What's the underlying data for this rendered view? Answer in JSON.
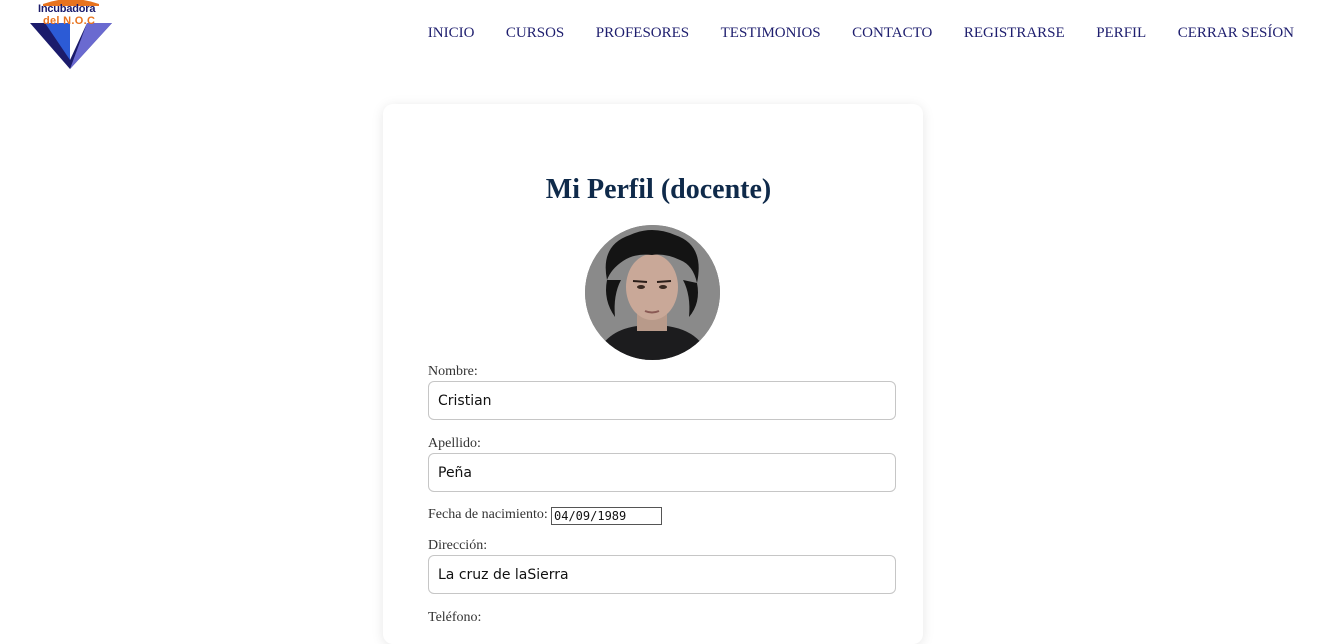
{
  "logo": {
    "line1": "Incubadora",
    "line2": "del N.O.C"
  },
  "nav": {
    "items": [
      "INICIO",
      "CURSOS",
      "PROFESORES",
      "TESTIMONIOS",
      "CONTACTO",
      "REGISTRARSE",
      "PERFIL",
      "CERRAR SESÍON"
    ]
  },
  "profile": {
    "title": "Mi Perfil (docente)",
    "nombre_label": "Nombre:",
    "nombre_value": "Cristian",
    "apellido_label": "Apellido:",
    "apellido_value": "Peña",
    "fecha_label": "Fecha de nacimiento:",
    "fecha_value": "04/09/1989",
    "direccion_label": "Dirección:",
    "direccion_value": "La cruz de laSierra",
    "telefono_label": "Teléfono:"
  },
  "colors": {
    "nav_text": "#1e1e6e",
    "title": "#0f2a4a",
    "logo_orange": "#e8731e",
    "logo_blue": "#1b1b6b"
  }
}
